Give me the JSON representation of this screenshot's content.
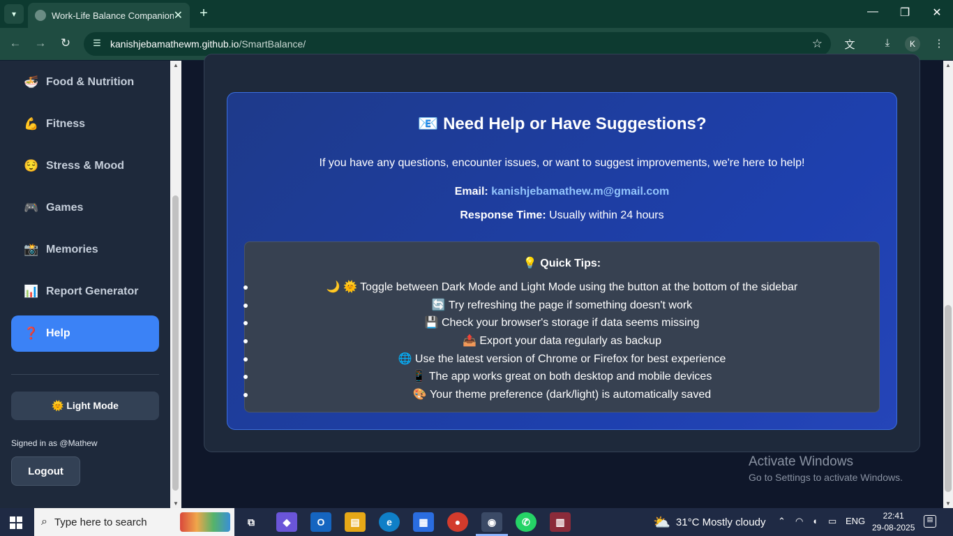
{
  "browser": {
    "tab_title": "Work-Life Balance Companion",
    "url_host": "kanishjebamathewm.github.io",
    "url_path": "/SmartBalance/",
    "profile_initial": "K"
  },
  "sidebar": {
    "items": [
      {
        "icon": "🍜",
        "label": "Food & Nutrition"
      },
      {
        "icon": "💪",
        "label": "Fitness"
      },
      {
        "icon": "😌",
        "label": "Stress & Mood"
      },
      {
        "icon": "🎮",
        "label": "Games"
      },
      {
        "icon": "📸",
        "label": "Memories"
      },
      {
        "icon": "📊",
        "label": "Report Generator"
      },
      {
        "icon": "❓",
        "label": "Help"
      }
    ],
    "mode_button": "🌞 Light Mode",
    "signed_in": "Signed in as @Mathew",
    "logout": "Logout"
  },
  "help": {
    "title": "📧 Need Help or Have Suggestions?",
    "intro": "If you have any questions, encounter issues, or want to suggest improvements, we're here to help!",
    "email_label": "Email:",
    "email": "kanishjebamathew.m@gmail.com",
    "response_label": "Response Time:",
    "response": "Usually within 24 hours",
    "tips_title": "💡 Quick Tips:",
    "tips": [
      "🌙 🌞 Toggle between Dark Mode and Light Mode using the button at the bottom of the sidebar",
      "🔄 Try refreshing the page if something doesn't work",
      "💾 Check your browser's storage if data seems missing",
      "📤 Export your data regularly as backup",
      "🌐 Use the latest version of Chrome or Firefox for best experience",
      "📱 The app works great on both desktop and mobile devices",
      "🎨 Your theme preference (dark/light) is automatically saved"
    ]
  },
  "watermark": {
    "line1": "Activate Windows",
    "line2": "Go to Settings to activate Windows."
  },
  "taskbar": {
    "search_placeholder": "Type here to search",
    "weather": "31°C  Mostly cloudy",
    "language": "ENG",
    "time": "22:41",
    "date": "29-08-2025"
  }
}
